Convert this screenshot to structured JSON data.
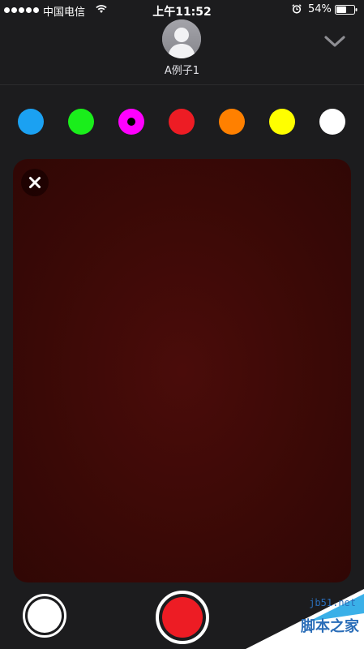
{
  "status_bar": {
    "carrier": "中国电信",
    "time": "上午11:52",
    "battery": "54%"
  },
  "header": {
    "contact_name": "A例子1"
  },
  "palette": {
    "colors": [
      "#1ba1f2",
      "#1aee1b",
      "#ff00ff",
      "#ed1c24",
      "#ff8000",
      "#ffff00",
      "#ffffff"
    ],
    "selected_index": 2
  },
  "canvas": {
    "background": "#3a0906"
  },
  "controls": {
    "record_color": "#ed1c24",
    "brush_color": "#ffffff"
  },
  "watermark": {
    "url": "jb51.net",
    "text": "脚本之家"
  },
  "icons": [
    "wifi-icon",
    "alarm-icon",
    "battery-icon",
    "avatar-person-icon",
    "chevron-down-icon",
    "close-icon"
  ]
}
